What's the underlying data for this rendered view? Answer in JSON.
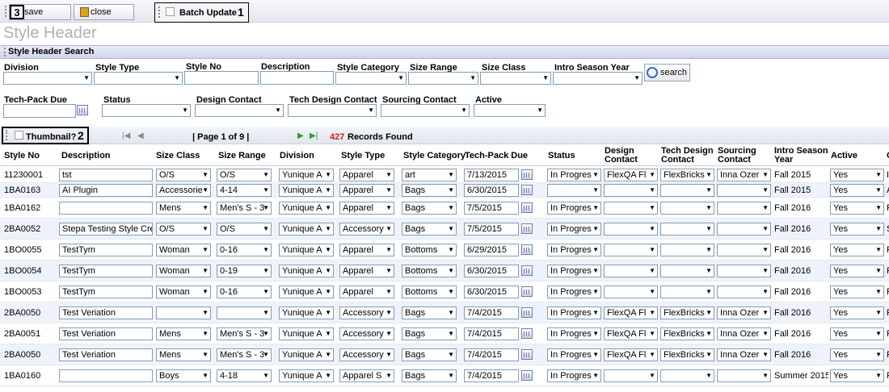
{
  "toolbar": {
    "save_label": "save",
    "close_label": "close",
    "batch_update_label": "Batch Update",
    "marker_1": "1",
    "marker_3": "3"
  },
  "page_title": "Style Header",
  "search": {
    "section_title": "Style Header Search",
    "labels": {
      "division": "Division",
      "style_type": "Style Type",
      "style_no": "Style No",
      "description": "Description",
      "style_category": "Style Category",
      "size_range": "Size Range",
      "size_class": "Size Class",
      "intro_season_year": "Intro Season Year",
      "tech_pack_due": "Tech-Pack Due",
      "status": "Status",
      "design_contact": "Design Contact",
      "tech_design_contact": "Tech Design Contact",
      "sourcing_contact": "Sourcing Contact",
      "active": "Active"
    },
    "search_button": "search"
  },
  "pager": {
    "thumbnail_label": "Thumbnail?",
    "marker_2": "2",
    "page_info": "| Page 1 of 9 |",
    "records_count": "427",
    "records_label": "Records Found"
  },
  "grid": {
    "headers": {
      "style_no": "Style No",
      "description": "Description",
      "size_class": "Size Class",
      "size_range": "Size Range",
      "division": "Division",
      "style_type": "Style Type",
      "style_category": "Style Category",
      "tech_pack_due": "Tech-Pack Due",
      "status": "Status",
      "design_contact_1": "Design",
      "design_contact_2": "Contact",
      "tech_design_contact_1": "Tech Design",
      "tech_design_contact_2": "Contact",
      "sourcing_contact_1": "Sourcing",
      "sourcing_contact_2": "Contact",
      "intro_season_year_1": "Intro Season",
      "intro_season_year_2": "Year",
      "active": "Active",
      "overflow": "C"
    },
    "rows": [
      {
        "style_no": "11230001",
        "description": "tst",
        "size_class": "O/S",
        "size_range": "O/S",
        "division": "Yunique A",
        "style_type": "Apparel",
        "style_category": "art",
        "tech_pack_due": "7/13/2015",
        "status": "In Progres",
        "design_contact": "FlexQA Fl",
        "tech_design_contact": "FlexBricks",
        "sourcing_contact": "Inna Ozer",
        "intro_season_year": "Fall 2015",
        "active": "Yes",
        "overflow": "I"
      },
      {
        "style_no": "1BA0163",
        "description": "AI Plugin",
        "size_class": "Accessorie",
        "size_range": "4-14",
        "division": "Yunique A",
        "style_type": "Apparel",
        "style_category": "Bags",
        "tech_pack_due": "6/30/2015",
        "status": "",
        "design_contact": "",
        "tech_design_contact": "",
        "sourcing_contact": "",
        "intro_season_year": "Fall 2015",
        "active": "Yes",
        "overflow": "A"
      },
      {
        "style_no": "1BA0162",
        "description": "",
        "size_class": "Mens",
        "size_range": "Men's S - 3",
        "division": "Yunique A",
        "style_type": "Apparel",
        "style_category": "Bags",
        "tech_pack_due": "7/5/2015",
        "status": "In Progres",
        "design_contact": "",
        "tech_design_contact": "",
        "sourcing_contact": "",
        "intro_season_year": "Fall 2016",
        "active": "Yes",
        "overflow": "F"
      },
      {
        "style_no": "2BA0052",
        "description": "Stepa Testing Style Creati",
        "size_class": "O/S",
        "size_range": "O/S",
        "division": "Yunique A",
        "style_type": "Accessory",
        "style_category": "Bags",
        "tech_pack_due": "7/5/2015",
        "status": "In Progres",
        "design_contact": "",
        "tech_design_contact": "",
        "sourcing_contact": "",
        "intro_season_year": "Fall 2016",
        "active": "Yes",
        "overflow": "S"
      },
      {
        "style_no": "1BO0055",
        "description": "TestTym",
        "size_class": "Woman",
        "size_range": "0-16",
        "division": "Yunique A",
        "style_type": "Apparel",
        "style_category": "Bottoms",
        "tech_pack_due": "6/29/2015",
        "status": "In Progres",
        "design_contact": "",
        "tech_design_contact": "",
        "sourcing_contact": "",
        "intro_season_year": "Fall 2016",
        "active": "Yes",
        "overflow": "F"
      },
      {
        "style_no": "1BO0054",
        "description": "TestTym",
        "size_class": "Woman",
        "size_range": "0-19",
        "division": "Yunique A",
        "style_type": "Apparel",
        "style_category": "Bottoms",
        "tech_pack_due": "6/30/2015",
        "status": "In Progres",
        "design_contact": "",
        "tech_design_contact": "",
        "sourcing_contact": "",
        "intro_season_year": "Fall 2016",
        "active": "Yes",
        "overflow": "F"
      },
      {
        "style_no": "1BO0053",
        "description": "TestTym",
        "size_class": "Woman",
        "size_range": "0-16",
        "division": "Yunique A",
        "style_type": "Apparel",
        "style_category": "Bottoms",
        "tech_pack_due": "6/30/2015",
        "status": "In Progres",
        "design_contact": "",
        "tech_design_contact": "",
        "sourcing_contact": "",
        "intro_season_year": "Fall 2016",
        "active": "Yes",
        "overflow": "F"
      },
      {
        "style_no": "2BA0050",
        "description": "Test Veriation",
        "size_class": "",
        "size_range": "",
        "division": "Yunique A",
        "style_type": "Accessory",
        "style_category": "Bags",
        "tech_pack_due": "7/4/2015",
        "status": "In Progres",
        "design_contact": "FlexQA Fl",
        "tech_design_contact": "FlexBricks",
        "sourcing_contact": "Inna Ozer",
        "intro_season_year": "Fall 2016",
        "active": "Yes",
        "overflow": "F"
      },
      {
        "style_no": "2BA0051",
        "description": "Test Veriation",
        "size_class": "Mens",
        "size_range": "Men's S - 3",
        "division": "Yunique A",
        "style_type": "Accessory",
        "style_category": "Bags",
        "tech_pack_due": "7/4/2015",
        "status": "In Progres",
        "design_contact": "FlexQA Fl",
        "tech_design_contact": "FlexBricks",
        "sourcing_contact": "Inna Ozer",
        "intro_season_year": "Fall 2016",
        "active": "Yes",
        "overflow": "F"
      },
      {
        "style_no": "2BA0050",
        "description": "Test Veriation",
        "size_class": "Mens",
        "size_range": "Men's S - 3",
        "division": "Yunique A",
        "style_type": "Accessory",
        "style_category": "Bags",
        "tech_pack_due": "7/4/2015",
        "status": "In Progres",
        "design_contact": "FlexQA Fl",
        "tech_design_contact": "FlexBricks",
        "sourcing_contact": "Inna Ozer",
        "intro_season_year": "Fall 2016",
        "active": "Yes",
        "overflow": "F"
      },
      {
        "style_no": "1BA0160",
        "description": "",
        "size_class": "Boys",
        "size_range": "4-18",
        "division": "Yunique A",
        "style_type": "Apparel S",
        "style_category": "Bags",
        "tech_pack_due": "7/4/2015",
        "status": "In Progres",
        "design_contact": "",
        "tech_design_contact": "",
        "sourcing_contact": "",
        "intro_season_year": "Summer 2015",
        "active": "Yes",
        "overflow": "F"
      }
    ]
  },
  "colors": {
    "records_count": "#cc2222",
    "title_gray": "#b0b0b0",
    "section_bar": "#cdd6ea",
    "row_alt": "#eef3fb"
  }
}
